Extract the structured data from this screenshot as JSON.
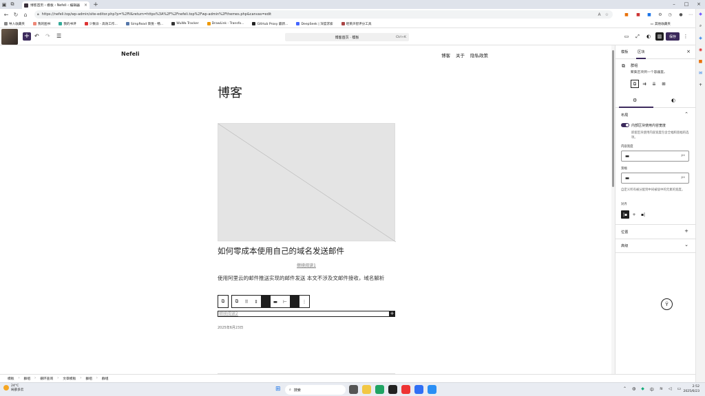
{
  "browser": {
    "tab_title": "博客首页 ‹ 模板 ‹ Nefeli ‹ 编辑器",
    "url": "https://nefeli.top/wp-admin/site-editor.php?p=%2Fil&return=https%3A%2F%2Fnefeli.top%2Fwp-admin%2Fthemes.php&canvas=edit",
    "bookmarks": [
      "导入收藏夹",
      "我的图书",
      "我的书评",
      "少数派 - 高效工作...",
      "SimpRead 简悦 - 畅...",
      "WuWa Tracker",
      "DrawLink - Transfo...",
      "GitHub Proxy 最新...",
      "DeepSeek | 深度求索",
      "哈莱声智评分工具"
    ],
    "other_bookmarks": "其他收藏夹"
  },
  "editor": {
    "command_text": "博客首页 · 模板",
    "command_shortcut": "Ctrl+K",
    "save_label": "保存"
  },
  "canvas": {
    "site_title": "Nefeli",
    "nav": [
      "博客",
      "关于",
      "隐私政策"
    ],
    "page_heading": "博客",
    "post_title": "如何零成本使用自己的域名发送邮件",
    "read_more_1": "继续阅读1",
    "excerpt": "使用阿里云的邮件推送实现的邮件发送 本文不涉及文邮件接收，域名解析",
    "read_more_2": "继续阅读2",
    "post_date": "2025年6月23日"
  },
  "sidebar": {
    "tab_template": "模板",
    "tab_block": "区块",
    "block_name": "群组",
    "block_desc": "聚集区块到一个容器里。",
    "layout_heading": "布局",
    "toggle_label": "内部区块使用内容宽度",
    "toggle_help": "嵌套区块使用内容宽度包含全幅和宽幅的选项。",
    "content_width_label": "内容宽度",
    "wide_width_label": "宽幅",
    "unit": "px",
    "width_help": "自定义所有被分配到中间被居中的元素的宽度。",
    "justify_label": "对齐",
    "position_heading": "位置",
    "advanced_heading": "高级"
  },
  "breadcrumb": [
    "模板",
    "群组",
    "循环查询",
    "文章模板",
    "群组",
    "群组"
  ],
  "taskbar": {
    "weather_temp": "24°C",
    "weather_desc": "局部多云",
    "search_placeholder": "搜索",
    "time": "2:52",
    "date": "2025/6/23"
  },
  "colors": {
    "wp_accent": "#3c2a5c",
    "toolbar_dark": "#1e1e1e",
    "placeholder_gray": "#e4e4e4"
  }
}
